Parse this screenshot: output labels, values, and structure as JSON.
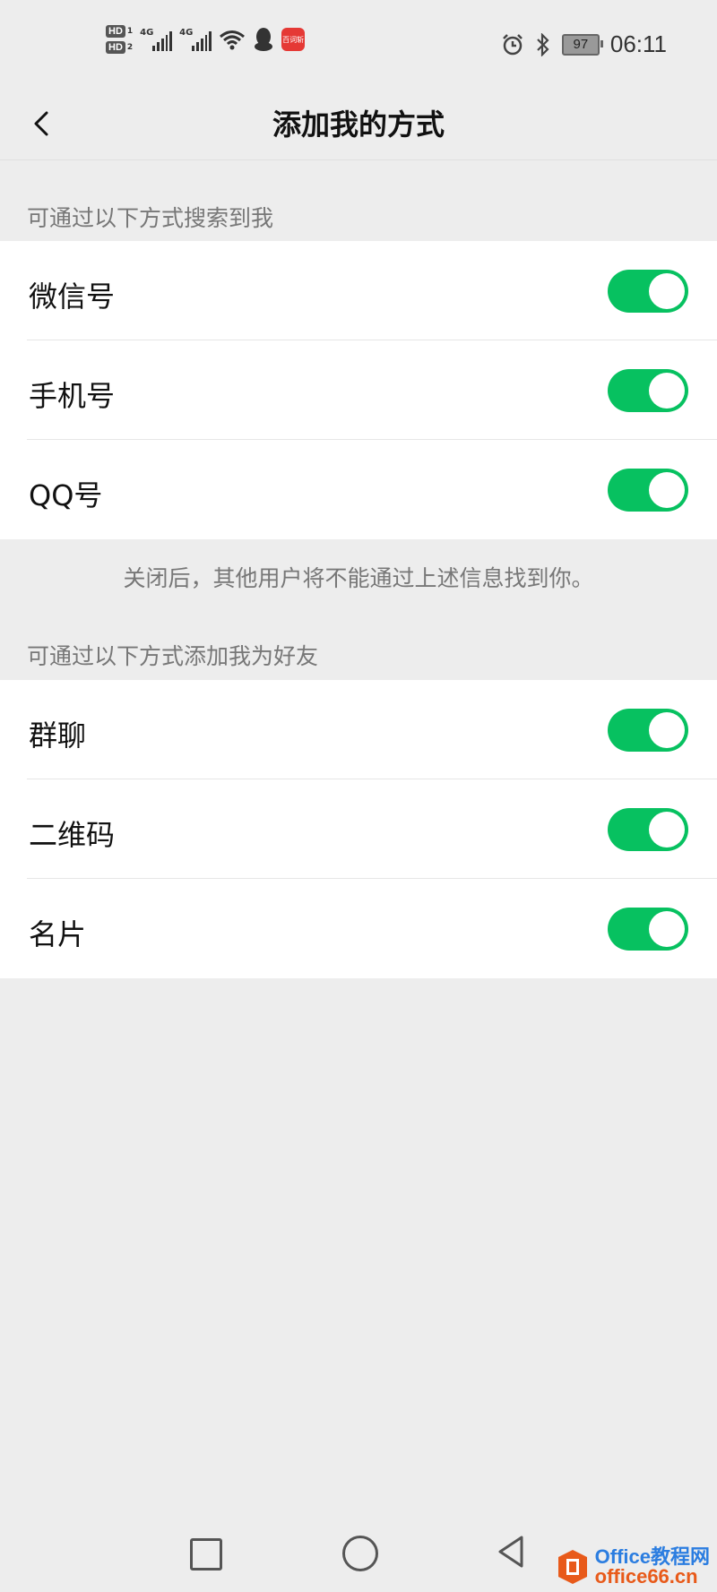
{
  "status_bar": {
    "hd1": "HD",
    "hd1_num": "1",
    "hd2": "HD",
    "hd2_num": "2",
    "signal1_label": "4G",
    "signal2_label": "4G",
    "app_badge_text": "百词斩",
    "battery": "97",
    "time": "06:11"
  },
  "header": {
    "title": "添加我的方式"
  },
  "search_section": {
    "label": "可通过以下方式搜索到我",
    "items": [
      {
        "label": "微信号",
        "enabled": true
      },
      {
        "label": "手机号",
        "enabled": true
      },
      {
        "label": "QQ号",
        "enabled": true
      }
    ],
    "note": "关闭后，其他用户将不能通过上述信息找到你。"
  },
  "add_section": {
    "label": "可通过以下方式添加我为好友",
    "items": [
      {
        "label": "群聊",
        "enabled": true
      },
      {
        "label": "二维码",
        "enabled": true
      },
      {
        "label": "名片",
        "enabled": true
      }
    ]
  },
  "colors": {
    "toggle_on": "#07c160",
    "background": "#ededed"
  },
  "watermark": {
    "line1": "Office教程网",
    "line2": "office66.cn"
  }
}
